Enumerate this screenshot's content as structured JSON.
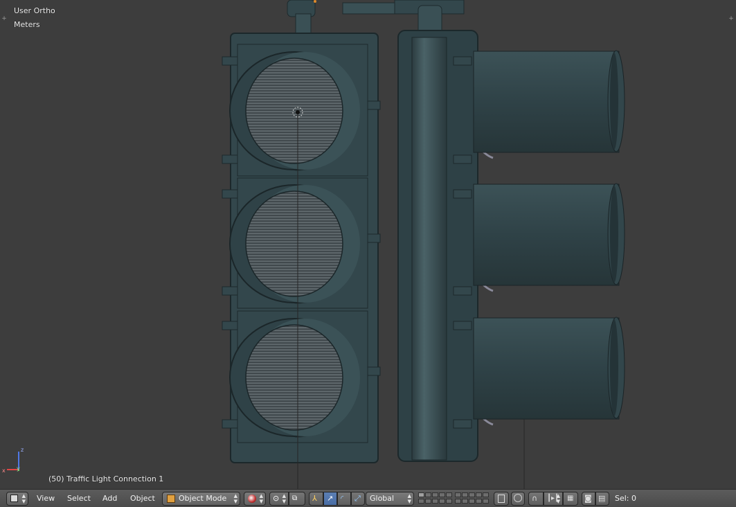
{
  "viewport": {
    "view_name": "User Ortho",
    "units": "Meters",
    "object_info": "(50) Traffic Light Connection 1",
    "axes": {
      "z": "z",
      "x": "x",
      "y": "y"
    }
  },
  "header": {
    "editor_type_icon": "3d-view-cube-icon",
    "menus": [
      "View",
      "Select",
      "Add",
      "Object"
    ],
    "mode": {
      "label": "Object Mode",
      "icon": "object-mode-cube-icon"
    },
    "viewport_shading_icon": "shading-sphere-icon",
    "pivot_icon": "pivot-point-icon",
    "manipulator_icons": [
      "manipulator-toggle-icon",
      "translate-icon",
      "rotate-icon",
      "scale-icon"
    ],
    "transform_orientation": "Global",
    "layers_icon": "layers-grid-icon",
    "lock_icon": "lock-camera-icon",
    "proportional_icon": "proportional-edit-icon",
    "snap_icons": [
      "snap-magnet-icon",
      "snap-element-icon",
      "snap-target-icon"
    ],
    "render_icons": [
      "opengl-render-icon",
      "opengl-animation-icon"
    ],
    "selection_status": "Sel: 0"
  },
  "colors": {
    "viewport_bg": "#3d3d3d",
    "housing": "#33474c",
    "header_bg": "#555555",
    "active_blue": "#5579b3"
  }
}
